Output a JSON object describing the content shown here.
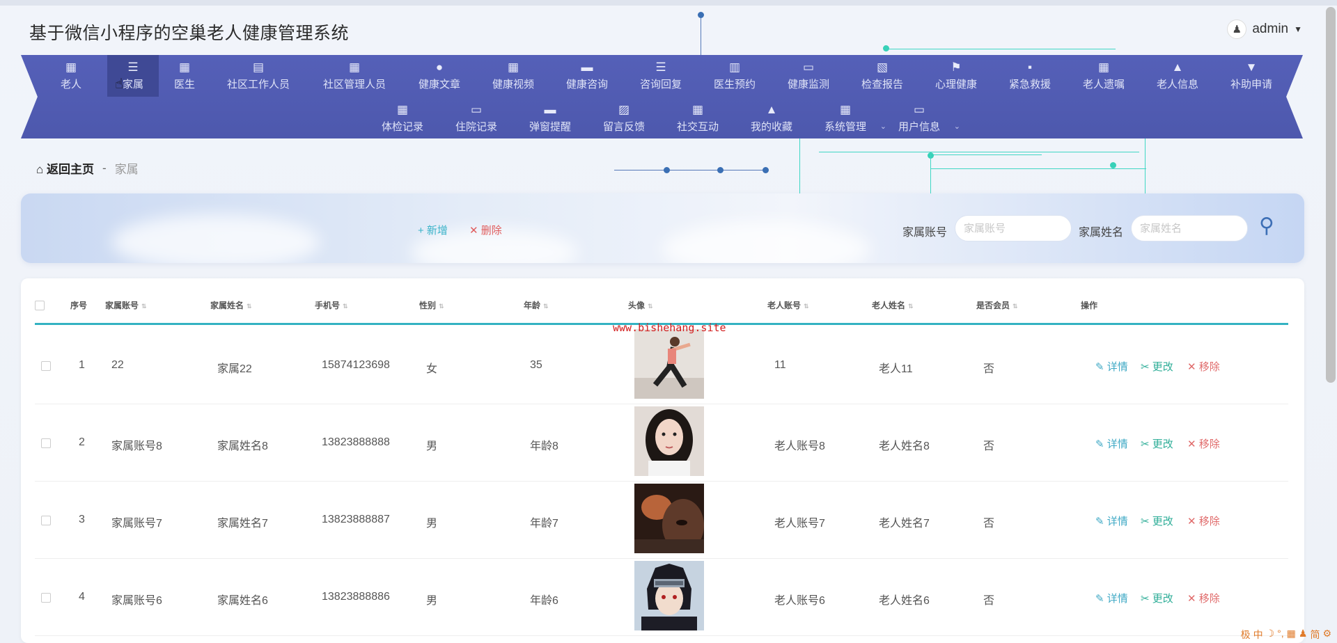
{
  "app": {
    "title": "基于微信小程序的空巢老人健康管理系统"
  },
  "user": {
    "name": "admin",
    "caret": "▼",
    "avatar_icon": "user-avatar-icon"
  },
  "nav": {
    "row1": [
      {
        "label": "老人",
        "icon": "grid-icon",
        "glyph": "▦"
      },
      {
        "label": "家属",
        "icon": "list-icon",
        "glyph": "☰",
        "active": true
      },
      {
        "label": "医生",
        "icon": "grid-icon",
        "glyph": "▦"
      },
      {
        "label": "社区工作人员",
        "icon": "clipboard-icon",
        "glyph": "▤"
      },
      {
        "label": "社区管理人员",
        "icon": "grid-icon",
        "glyph": "▦"
      },
      {
        "label": "健康文章",
        "icon": "bulb-icon",
        "glyph": "●"
      },
      {
        "label": "健康视频",
        "icon": "grid-icon",
        "glyph": "▦"
      },
      {
        "label": "健康咨询",
        "icon": "briefcase-icon",
        "glyph": "▬"
      },
      {
        "label": "咨询回复",
        "icon": "list-icon",
        "glyph": "☰"
      },
      {
        "label": "医生预约",
        "icon": "book-icon",
        "glyph": "▥"
      },
      {
        "label": "健康监测",
        "icon": "monitor-icon",
        "glyph": "▭"
      },
      {
        "label": "检查报告",
        "icon": "report-icon",
        "glyph": "▧"
      },
      {
        "label": "心理健康",
        "icon": "flag-icon",
        "glyph": "⚑"
      },
      {
        "label": "紧急救援",
        "icon": "chat-icon",
        "glyph": "▪"
      },
      {
        "label": "老人遗嘱",
        "icon": "grid-icon",
        "glyph": "▦"
      },
      {
        "label": "老人信息",
        "icon": "person-icon",
        "glyph": "▲"
      },
      {
        "label": "补助申请",
        "icon": "sign-icon",
        "glyph": "▼"
      }
    ],
    "row2": [
      {
        "label": "体检记录",
        "icon": "grid-icon",
        "glyph": "▦"
      },
      {
        "label": "住院记录",
        "icon": "monitor-icon",
        "glyph": "▭"
      },
      {
        "label": "弹窗提醒",
        "icon": "bell-icon",
        "glyph": "▬"
      },
      {
        "label": "留言反馈",
        "icon": "chart-icon",
        "glyph": "▨"
      },
      {
        "label": "社交互动",
        "icon": "grid-icon",
        "glyph": "▦"
      },
      {
        "label": "我的收藏",
        "icon": "person-icon",
        "glyph": "▲"
      },
      {
        "label": "系统管理",
        "icon": "grid-icon",
        "glyph": "▦",
        "has_sub": true
      },
      {
        "label": "用户信息",
        "icon": "card-icon",
        "glyph": "▭",
        "has_sub": true
      }
    ]
  },
  "breadcrumb": {
    "home": "返回主页",
    "separator": "-",
    "current": "家属"
  },
  "toolbar": {
    "add_label": "+ 新增",
    "delete_label": "✕ 删除"
  },
  "filters": [
    {
      "label": "家属账号",
      "placeholder": "家属账号"
    },
    {
      "label": "家属姓名",
      "placeholder": "家属姓名"
    }
  ],
  "table": {
    "headers": [
      "序号",
      "家属账号",
      "家属姓名",
      "手机号",
      "性别",
      "年龄",
      "头像",
      "老人账号",
      "老人姓名",
      "是否会员",
      "操作"
    ],
    "rows": [
      {
        "index": "1",
        "account": "22",
        "name": "家属22",
        "phone": "15874123698",
        "gender": "女",
        "age": "35",
        "avatar": "dancer",
        "elder_account": "11",
        "elder_name": "老人11",
        "member": "否"
      },
      {
        "index": "2",
        "account": "家属账号8",
        "name": "家属姓名8",
        "phone": "13823888888",
        "gender": "男",
        "age": "年龄8",
        "avatar": "girl",
        "elder_account": "老人账号8",
        "elder_name": "老人姓名8",
        "member": "否"
      },
      {
        "index": "3",
        "account": "家属账号7",
        "name": "家属姓名7",
        "phone": "13823888887",
        "gender": "男",
        "age": "年龄7",
        "avatar": "dark",
        "elder_account": "老人账号7",
        "elder_name": "老人姓名7",
        "member": "否"
      },
      {
        "index": "4",
        "account": "家属账号6",
        "name": "家属姓名6",
        "phone": "13823888886",
        "gender": "男",
        "age": "年龄6",
        "avatar": "anime",
        "elder_account": "老人账号6",
        "elder_name": "老人姓名6",
        "member": "否"
      }
    ],
    "actions": {
      "detail": "详情",
      "edit": "更改",
      "remove": "移除"
    }
  },
  "watermark": "www.bishehang.site",
  "tray": [
    "极",
    "中",
    "☽",
    "°,",
    "▦",
    "♟",
    "简",
    "⚙"
  ],
  "colors": {
    "nav_bg": "#5560b8",
    "accent": "#34b2c2",
    "danger": "#e05c5c"
  }
}
